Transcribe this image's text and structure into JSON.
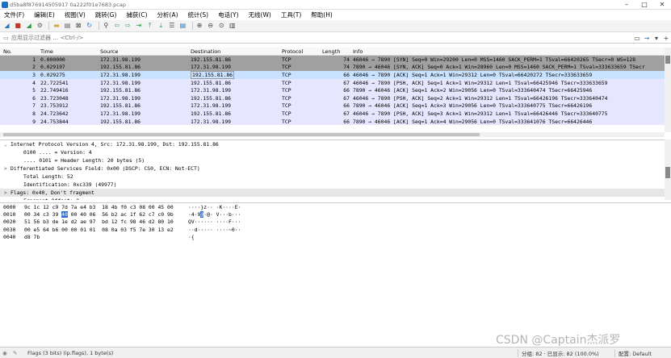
{
  "window": {
    "title": "d5ba8f876914505917 0a222f01e7683.pcap"
  },
  "menu": [
    "文件(F)",
    "编辑(E)",
    "视图(V)",
    "跳转(G)",
    "捕获(C)",
    "分析(A)",
    "统计(S)",
    "电话(Y)",
    "无线(W)",
    "工具(T)",
    "帮助(H)"
  ],
  "filter": {
    "placeholder": "应用显示过滤器 … <Ctrl-/>"
  },
  "packet_list": {
    "columns": [
      "No.",
      "Time",
      "Source",
      "Destination",
      "Protocol",
      "Length",
      "Info"
    ],
    "rows": [
      {
        "no": "1",
        "time": "0.000000",
        "src": "172.31.98.199",
        "dst": "192.155.81.86",
        "proto": "TCP",
        "len": "74",
        "info": "46046 → 7890 [SYN] Seq=0 Win=29200 Len=0 MSS=1460 SACK_PERM=1 TSval=66420265 TSecr=0 WS=128",
        "style": "gray"
      },
      {
        "no": "2",
        "time": "0.029197",
        "src": "192.155.81.86",
        "dst": "172.31.98.199",
        "proto": "TCP",
        "len": "74",
        "info": "7890 → 46046 [SYN, ACK] Seq=0 Ack=1 Win=28960 Len=0 MSS=1460 SACK_PERM=1 TSval=333633659 TSecr",
        "style": "gray"
      },
      {
        "no": "3",
        "time": "0.029275",
        "src": "172.31.98.199",
        "dst": "192.155.81.86",
        "proto": "TCP",
        "len": "66",
        "info": "46046 → 7890 [ACK] Seq=1 Ack=1 Win=29312 Len=0 TSval=66420272 TSecr=333633659",
        "style": "sel"
      },
      {
        "no": "4",
        "time": "22.722541",
        "src": "172.31.98.199",
        "dst": "192.155.81.86",
        "proto": "TCP",
        "len": "67",
        "info": "46046 → 7890 [PSH, ACK] Seq=1 Ack=1 Win=29312 Len=1 TSval=66425946 TSecr=333633659",
        "style": "tcp"
      },
      {
        "no": "5",
        "time": "22.749416",
        "src": "192.155.81.86",
        "dst": "172.31.98.199",
        "proto": "TCP",
        "len": "66",
        "info": "7890 → 46046 [ACK] Seq=1 Ack=2 Win=29056 Len=0 TSval=333640474 TSecr=66425946",
        "style": "tcp"
      },
      {
        "no": "6",
        "time": "23.723048",
        "src": "172.31.98.199",
        "dst": "192.155.81.86",
        "proto": "TCP",
        "len": "67",
        "info": "46046 → 7890 [PSH, ACK] Seq=2 Ack=1 Win=29312 Len=1 TSval=66426196 TSecr=333640474",
        "style": "tcp"
      },
      {
        "no": "7",
        "time": "23.753912",
        "src": "192.155.81.86",
        "dst": "172.31.98.199",
        "proto": "TCP",
        "len": "66",
        "info": "7890 → 46046 [ACK] Seq=1 Ack=3 Win=29056 Len=0 TSval=333640775 TSecr=66426196",
        "style": "tcp"
      },
      {
        "no": "8",
        "time": "24.723642",
        "src": "172.31.98.199",
        "dst": "192.155.81.86",
        "proto": "TCP",
        "len": "67",
        "info": "46046 → 7890 [PSH, ACK] Seq=3 Ack=1 Win=29312 Len=1 TSval=66426446 TSecr=333640775",
        "style": "tcp"
      },
      {
        "no": "9",
        "time": "24.753844",
        "src": "192.155.81.86",
        "dst": "172.31.98.199",
        "proto": "TCP",
        "len": "66",
        "info": "7890 → 46046 [ACK] Seq=1 Ack=4 Win=29056 Len=0 TSval=333641076 TSecr=66426446",
        "style": "tcp"
      }
    ]
  },
  "details": [
    {
      "text": "Internet Protocol Version 4, Src: 172.31.98.199, Dst: 192.155.81.86",
      "level": 0,
      "arrow": "⌄",
      "sel": false
    },
    {
      "text": "0100 .... = Version: 4",
      "level": 2,
      "arrow": "",
      "sel": false
    },
    {
      "text": ".... 0101 = Header Length: 20 bytes (5)",
      "level": 2,
      "arrow": "",
      "sel": false
    },
    {
      "text": "Differentiated Services Field: 0x00 (DSCP: CS0, ECN: Not-ECT)",
      "level": 1,
      "arrow": ">",
      "sel": false
    },
    {
      "text": "Total Length: 52",
      "level": 2,
      "arrow": "",
      "sel": false
    },
    {
      "text": "Identification: 0xc339 (49977)",
      "level": 2,
      "arrow": "",
      "sel": false
    },
    {
      "text": "Flags: 0x40, Don't fragment",
      "level": 1,
      "arrow": ">",
      "sel": true
    },
    {
      "text": "Fragment Offset: 0",
      "level": 2,
      "arrow": "",
      "sel": false
    }
  ],
  "bytes": [
    {
      "off": "0000",
      "hex_a": "9c 1c 12 c9 7d 7a e4 b3  18 4b f0 c3 08 00 45 00",
      "hex_hl": "",
      "hex_b": "",
      "ascii_a": "····}z·· ·K····E·",
      "ascii_hl": "",
      "ascii_b": ""
    },
    {
      "off": "0010",
      "hex_a": "00 34 c3 39 ",
      "hex_hl": "40",
      "hex_b": " 00 40 06  56 b2 ac 1f 62 c7 c0 9b",
      "ascii_a": "·4·9",
      "ascii_hl": "@",
      "ascii_b": "·@· V···b···"
    },
    {
      "off": "0020",
      "hex_a": "51 56 b3 de 1e d2 ae 97  bd 12 fc 98 46 d2 80 10",
      "hex_hl": "",
      "hex_b": "",
      "ascii_a": "QV······ ····F···",
      "ascii_hl": "",
      "ascii_b": ""
    },
    {
      "off": "0030",
      "hex_a": "00 e5 64 b6 00 00 01 01  08 0a 03 f5 7e 30 13 e2",
      "hex_hl": "",
      "hex_b": "",
      "ascii_a": "··d····· ····~0··",
      "ascii_hl": "",
      "ascii_b": ""
    },
    {
      "off": "0040",
      "hex_a": "d8 7b",
      "hex_hl": "",
      "hex_b": "",
      "ascii_a": "·{",
      "ascii_hl": "",
      "ascii_b": ""
    }
  ],
  "status": {
    "field": "Flags (3 bits) (ip.flags), 1 byte(s)",
    "counts": "分组: 82 · 已显示: 82 (100.0%)",
    "profile": "配置: Default"
  },
  "watermark": "CSDN @Captain杰派罗"
}
